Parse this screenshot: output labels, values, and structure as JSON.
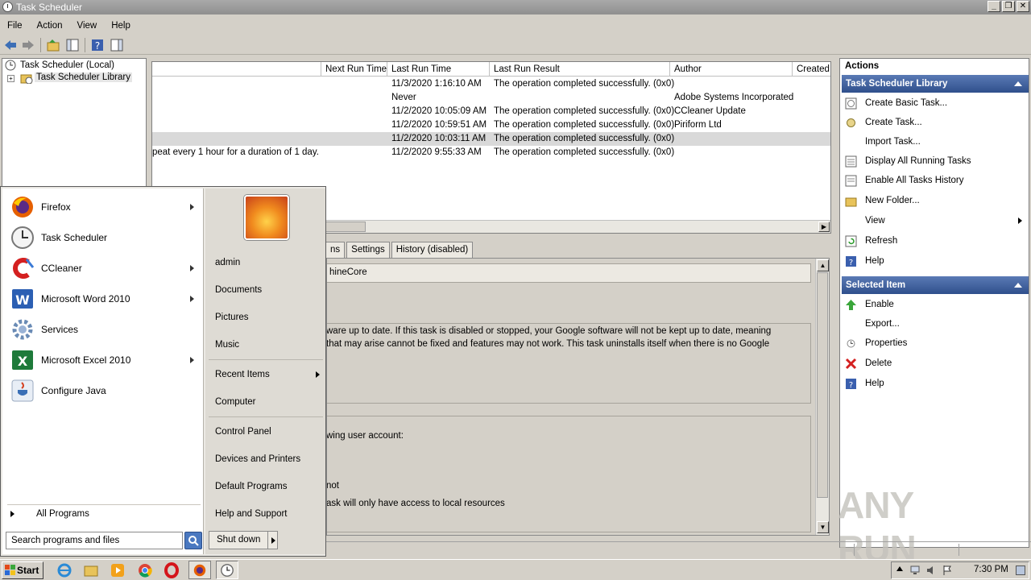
{
  "window": {
    "title": "Task Scheduler"
  },
  "menubar": [
    "File",
    "Action",
    "View",
    "Help"
  ],
  "tree": {
    "root": "Task Scheduler (Local)",
    "child": "Task Scheduler Library"
  },
  "tasklist": {
    "columns": [
      "Next Run Time",
      "Last Run Time",
      "Last Run Result",
      "Author",
      "Created"
    ],
    "rows": [
      {
        "trigger": "",
        "last_run": "11/3/2020 1:16:10 AM",
        "result": "The operation completed successfully. (0x0)",
        "author": ""
      },
      {
        "trigger": "",
        "last_run": "Never",
        "result": "",
        "author": "Adobe Systems Incorporated"
      },
      {
        "trigger": "",
        "last_run": "11/2/2020 10:05:09 AM",
        "result": "The operation completed successfully. (0x0)",
        "author": "CCleaner Update"
      },
      {
        "trigger": "",
        "last_run": "11/2/2020 10:59:51 AM",
        "result": "The operation completed successfully. (0x0)",
        "author": "Piriform Ltd"
      },
      {
        "trigger": "",
        "last_run": "11/2/2020 10:03:11 AM",
        "result": "The operation completed successfully. (0x0)",
        "author": ""
      },
      {
        "trigger": "peat every 1 hour for a duration of 1 day.",
        "last_run": "11/2/2020 9:55:33 AM",
        "result": "The operation completed successfully. (0x0)",
        "author": ""
      }
    ]
  },
  "detail": {
    "tabs": [
      "ns",
      "Settings",
      "History (disabled)"
    ],
    "name_value": "hineCore",
    "description_line1": "ware up to date. If this task is disabled or stopped, your Google software will not be kept up to date, meaning",
    "description_line2": "that may arise cannot be fixed and features may not work. This task uninstalls itself when there is no Google",
    "security_line1": "wing user account:",
    "security_line2": "not",
    "security_line3": "ask will only have access to local resources"
  },
  "actions": {
    "header": "Actions",
    "library_section": "Task Scheduler Library",
    "library_items": [
      "Create Basic Task...",
      "Create Task...",
      "Import Task...",
      "Display All Running Tasks",
      "Enable All Tasks History",
      "New Folder...",
      "View",
      "Refresh",
      "Help"
    ],
    "selected_section": "Selected Item",
    "selected_items": [
      "Enable",
      "Export...",
      "Properties",
      "Delete",
      "Help"
    ]
  },
  "startmenu": {
    "programs": [
      {
        "label": "Firefox",
        "icon": "firefox-icon",
        "arrow": true
      },
      {
        "label": "Task Scheduler",
        "icon": "clock-icon",
        "arrow": false
      },
      {
        "label": "CCleaner",
        "icon": "ccleaner-icon",
        "arrow": true
      },
      {
        "label": "Microsoft Word 2010",
        "icon": "word-icon",
        "arrow": true
      },
      {
        "label": "Services",
        "icon": "gear-icon",
        "arrow": false
      },
      {
        "label": "Microsoft Excel 2010",
        "icon": "excel-icon",
        "arrow": true
      },
      {
        "label": "Configure Java",
        "icon": "java-icon",
        "arrow": false
      }
    ],
    "all_programs": "All Programs",
    "search_placeholder": "Search programs and files",
    "right_items": [
      "admin",
      "Documents",
      "Pictures",
      "Music",
      "Recent Items",
      "Computer",
      "Control Panel",
      "Devices and Printers",
      "Default Programs",
      "Help and Support"
    ],
    "shutdown": "Shut down"
  },
  "taskbar": {
    "start": "Start",
    "clock": "7:30 PM"
  },
  "watermark": "ANY RUN"
}
